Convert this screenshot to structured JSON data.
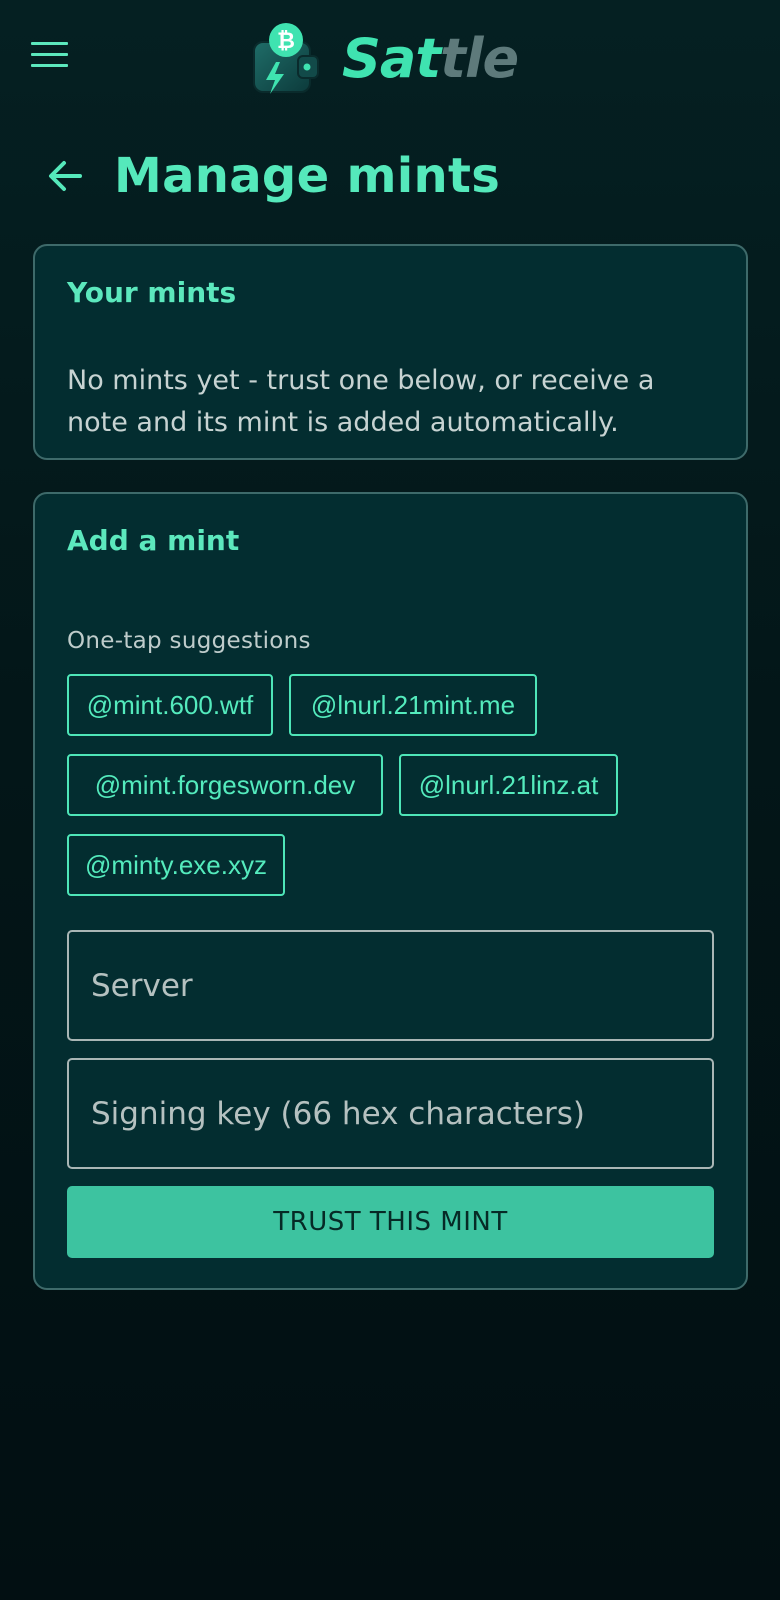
{
  "header": {
    "brand_part1": "Sat",
    "brand_part2": "tle",
    "menu_icon": "hamburger-menu-icon",
    "logo_icon": "wallet-bitcoin-lightning-icon"
  },
  "page": {
    "title": "Manage mints",
    "back_icon": "arrow-left-icon"
  },
  "your_mints": {
    "title": "Your mints",
    "empty_message": "No mints yet - trust one below, or receive a note and its mint is added automatically."
  },
  "add_mint": {
    "title": "Add a mint",
    "suggestions_label": "One-tap suggestions",
    "suggestions": [
      "@mint.600.wtf",
      "@lnurl.21mint.me",
      "@mint.forgesworn.dev",
      "@lnurl.21linz.at",
      "@minty.exe.xyz"
    ],
    "server_placeholder": "Server",
    "server_value": "",
    "key_placeholder": "Signing key (66 hex characters)",
    "key_value": "",
    "submit_label": "TRUST THIS MINT"
  },
  "colors": {
    "accent": "#55e9bb",
    "button": "#3dc3a0",
    "card": "#032d30",
    "background": "#031618"
  }
}
